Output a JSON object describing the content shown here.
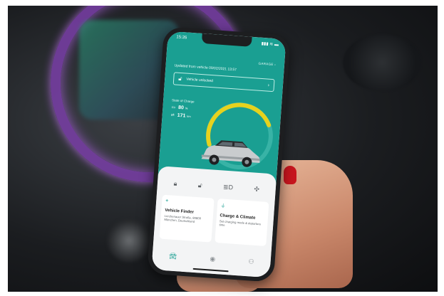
{
  "status_bar": {
    "time": "15:26",
    "signal": "▮▮▮ ≋ ▬"
  },
  "header": {
    "garage_link": "GARAGE ›",
    "updated_text": "Updated from vehicle 09/02/2021 13:57"
  },
  "lock": {
    "label": "Vehicle unlocked",
    "icon": "unlock-icon"
  },
  "charge": {
    "title": "State of Charge",
    "percent": "80",
    "percent_unit": "%",
    "range": "171",
    "range_unit": "km",
    "level": 0.8,
    "accent": "#e6d21e"
  },
  "quick_actions": [
    {
      "name": "lock-icon",
      "glyph": "🔒︎"
    },
    {
      "name": "unlock-icon",
      "glyph": "🔓︎"
    },
    {
      "name": "headlights-icon",
      "glyph": "≣D"
    },
    {
      "name": "fan-icon",
      "glyph": "✣"
    }
  ],
  "cards": {
    "finder": {
      "title": "Vehicle Finder",
      "subtitle": "Lerchenauer Straße, 80809 München, Deutschland"
    },
    "charge": {
      "title": "Charge & Climate",
      "subtitle": "Set charging mode & departure time"
    }
  },
  "tabs": [
    {
      "name": "tab-vehicle",
      "glyph": "🚘︎"
    },
    {
      "name": "tab-map",
      "glyph": "◉"
    },
    {
      "name": "tab-profile",
      "glyph": "⚇"
    }
  ],
  "colors": {
    "teal": "#1a9f92",
    "nail": "#c8161e"
  }
}
